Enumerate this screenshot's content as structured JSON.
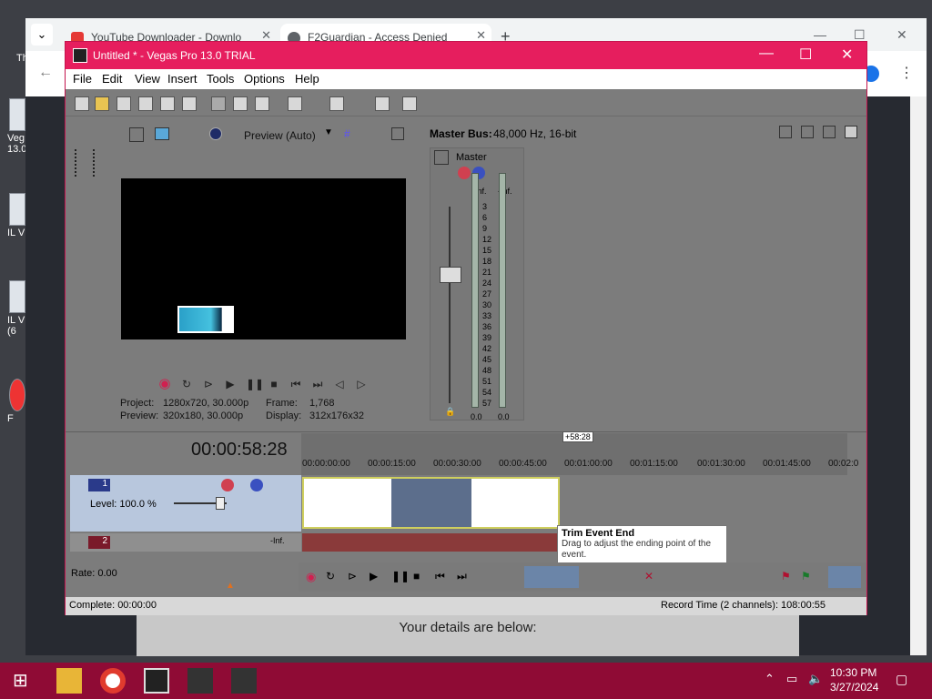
{
  "desktop": {
    "icons": [
      "Th",
      "Veg\n13.0",
      "IL V",
      "IL V\n(6",
      "F"
    ]
  },
  "browser": {
    "tabs": [
      {
        "label": "YouTube Downloader - Downlo",
        "active": false
      },
      {
        "label": "F2Guardian - Access Denied",
        "active": true
      }
    ],
    "new_tab": "+",
    "page_text": "Your details are below:"
  },
  "vegas": {
    "title": "Untitled * - Vegas Pro 13.0 TRIAL",
    "menu": [
      "File",
      "Edit",
      "View",
      "Insert",
      "Tools",
      "Options",
      "Help"
    ],
    "preview": {
      "mode": "Preview (Auto)",
      "project_label": "Project:",
      "project_value": "1280x720, 30.000p",
      "preview_label": "Preview:",
      "preview_value": "320x180, 30.000p",
      "frame_label": "Frame:",
      "frame_value": "1,768",
      "display_label": "Display:",
      "display_value": "312x176x32"
    },
    "master": {
      "header_label": "Master Bus:",
      "header_value": "48,000 Hz, 16-bit",
      "strip_name": "Master",
      "left_peak": "-Inf.",
      "right_peak": "-Inf.",
      "scale": [
        "3",
        "6",
        "9",
        "12",
        "15",
        "18",
        "21",
        "24",
        "27",
        "30",
        "33",
        "36",
        "39",
        "42",
        "45",
        "48",
        "51",
        "54",
        "57"
      ],
      "left_value": "0.0",
      "right_value": "0.0"
    },
    "timeline": {
      "timecode": "00:00:58:28",
      "cursor_marker": "+58:28",
      "ruler": [
        "00:00:00:00",
        "00:00:15:00",
        "00:00:30:00",
        "00:00:45:00",
        "00:01:00:00",
        "00:01:15:00",
        "00:01:30:00",
        "00:01:45:00",
        "00:02:0"
      ],
      "track1_num": "1",
      "track1_level": "Level: 100.0 %",
      "track2_num": "2",
      "track2_peak": "-Inf.",
      "rate": "Rate: 0.00"
    },
    "tooltip": {
      "title": "Trim Event End",
      "body": "Drag to adjust the ending point of the event."
    },
    "status": {
      "left": "Complete: 00:00:00",
      "right": "Record Time (2 channels): 108:00:55"
    }
  },
  "taskbar": {
    "time": "10:30 PM",
    "date": "3/27/2024"
  }
}
